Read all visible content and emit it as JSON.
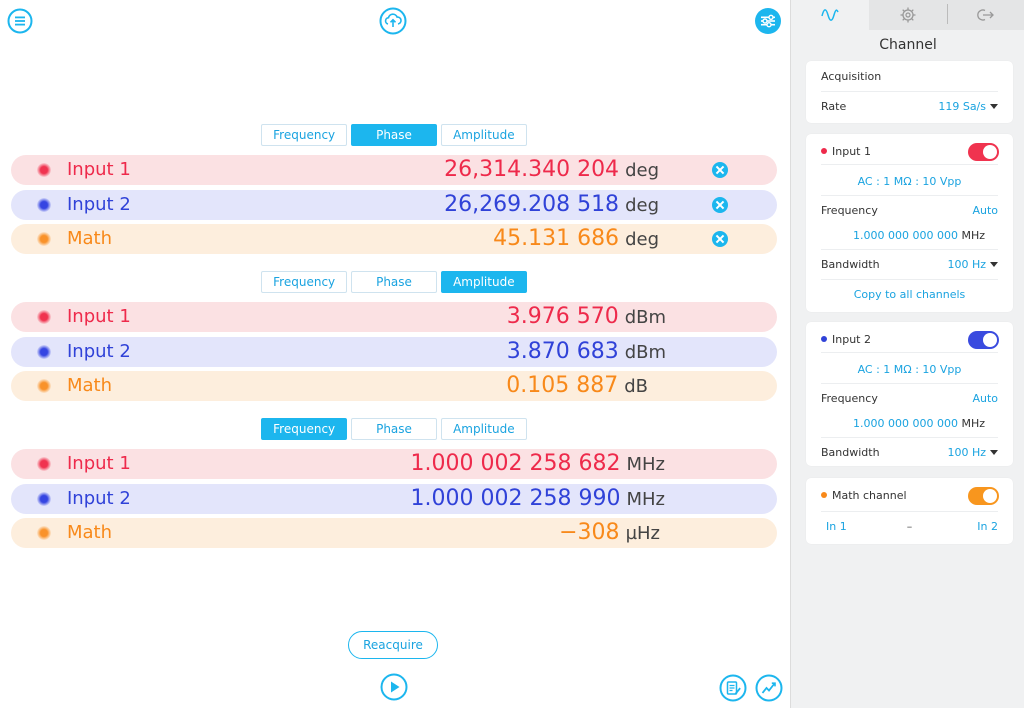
{
  "colors": {
    "accent": "#1cb6ee",
    "input1": "#ee2a4b",
    "input2": "#3042d8",
    "math": "#f8891a"
  },
  "toolbar": {
    "menu_icon": "menu-icon",
    "upload_icon": "cloud-upload-icon",
    "settings_icon": "sliders-icon"
  },
  "segments": [
    "Frequency",
    "Phase",
    "Amplitude"
  ],
  "groups": [
    {
      "active": "Phase",
      "rows": [
        {
          "label": "Input 1",
          "value": "26,314.340 204",
          "unit": "deg",
          "clear": true
        },
        {
          "label": "Input 2",
          "value": "26,269.208 518",
          "unit": "deg",
          "clear": true
        },
        {
          "label": "Math",
          "value": "45.131 686",
          "unit": "deg",
          "clear": true
        }
      ]
    },
    {
      "active": "Amplitude",
      "rows": [
        {
          "label": "Input 1",
          "value": "3.976 570",
          "unit": "dBm"
        },
        {
          "label": "Input 2",
          "value": "3.870 683",
          "unit": "dBm"
        },
        {
          "label": "Math",
          "value": "0.105 887",
          "unit": "dB"
        }
      ]
    },
    {
      "active": "Frequency",
      "rows": [
        {
          "label": "Input 1",
          "value": "1.000 002 258 682",
          "unit": "MHz"
        },
        {
          "label": "Input 2",
          "value": "1.000 002 258 990",
          "unit": "MHz"
        },
        {
          "label": "Math",
          "value": "−308",
          "unit": "µHz"
        }
      ]
    }
  ],
  "reacquire_label": "Reacquire",
  "panel": {
    "tabs": [
      "waveform-icon",
      "gear-icon",
      "logout-icon"
    ],
    "title": "Channel",
    "acquisition": {
      "header": "Acquisition",
      "rate_label": "Rate",
      "rate_value": "119 Sa/s"
    },
    "input1": {
      "title": "Input 1",
      "enabled": true,
      "coupling": "AC : 1 MΩ : 10 Vpp",
      "freq_label": "Frequency",
      "freq_mode": "Auto",
      "freq_value": "1.000 000 000 000",
      "freq_unit": "MHz",
      "bw_label": "Bandwidth",
      "bw_value": "100 Hz",
      "copy_label": "Copy to all channels"
    },
    "input2": {
      "title": "Input 2",
      "enabled": true,
      "coupling": "AC : 1 MΩ : 10 Vpp",
      "freq_label": "Frequency",
      "freq_mode": "Auto",
      "freq_value": "1.000 000 000 000",
      "freq_unit": "MHz",
      "bw_label": "Bandwidth",
      "bw_value": "100 Hz"
    },
    "math": {
      "title": "Math channel",
      "enabled": true,
      "left": "In 1",
      "op": "–",
      "right": "In 2"
    }
  }
}
